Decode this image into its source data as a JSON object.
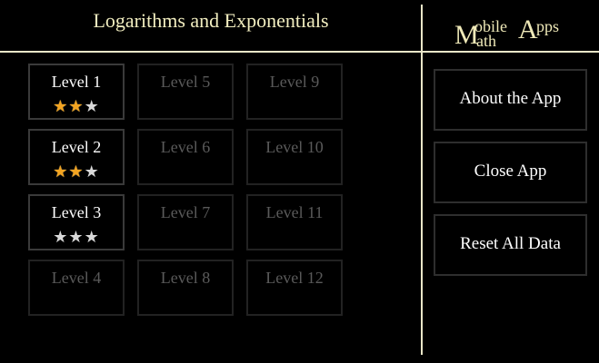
{
  "header": {
    "title": "Logarithms and Exponentials"
  },
  "logo": {
    "m": "M",
    "obile": "obile",
    "ath": "ath",
    "a": "A",
    "pps": "pps"
  },
  "levels": [
    {
      "label": "Level 1",
      "unlocked": true,
      "stars": 2
    },
    {
      "label": "Level 2",
      "unlocked": true,
      "stars": 2
    },
    {
      "label": "Level 3",
      "unlocked": true,
      "stars": 0
    },
    {
      "label": "Level 4",
      "unlocked": false
    },
    {
      "label": "Level 5",
      "unlocked": false
    },
    {
      "label": "Level 6",
      "unlocked": false
    },
    {
      "label": "Level 7",
      "unlocked": false
    },
    {
      "label": "Level 8",
      "unlocked": false
    },
    {
      "label": "Level 9",
      "unlocked": false
    },
    {
      "label": "Level 10",
      "unlocked": false
    },
    {
      "label": "Level 11",
      "unlocked": false
    },
    {
      "label": "Level 12",
      "unlocked": false
    }
  ],
  "stars_max": 3,
  "colors": {
    "star_on": "#f2a421",
    "star_off": "#d8d8d8",
    "title": "#f2eec0"
  },
  "sidebar": {
    "about_label": "About the App",
    "close_label": "Close App",
    "reset_label": "Reset All Data"
  }
}
